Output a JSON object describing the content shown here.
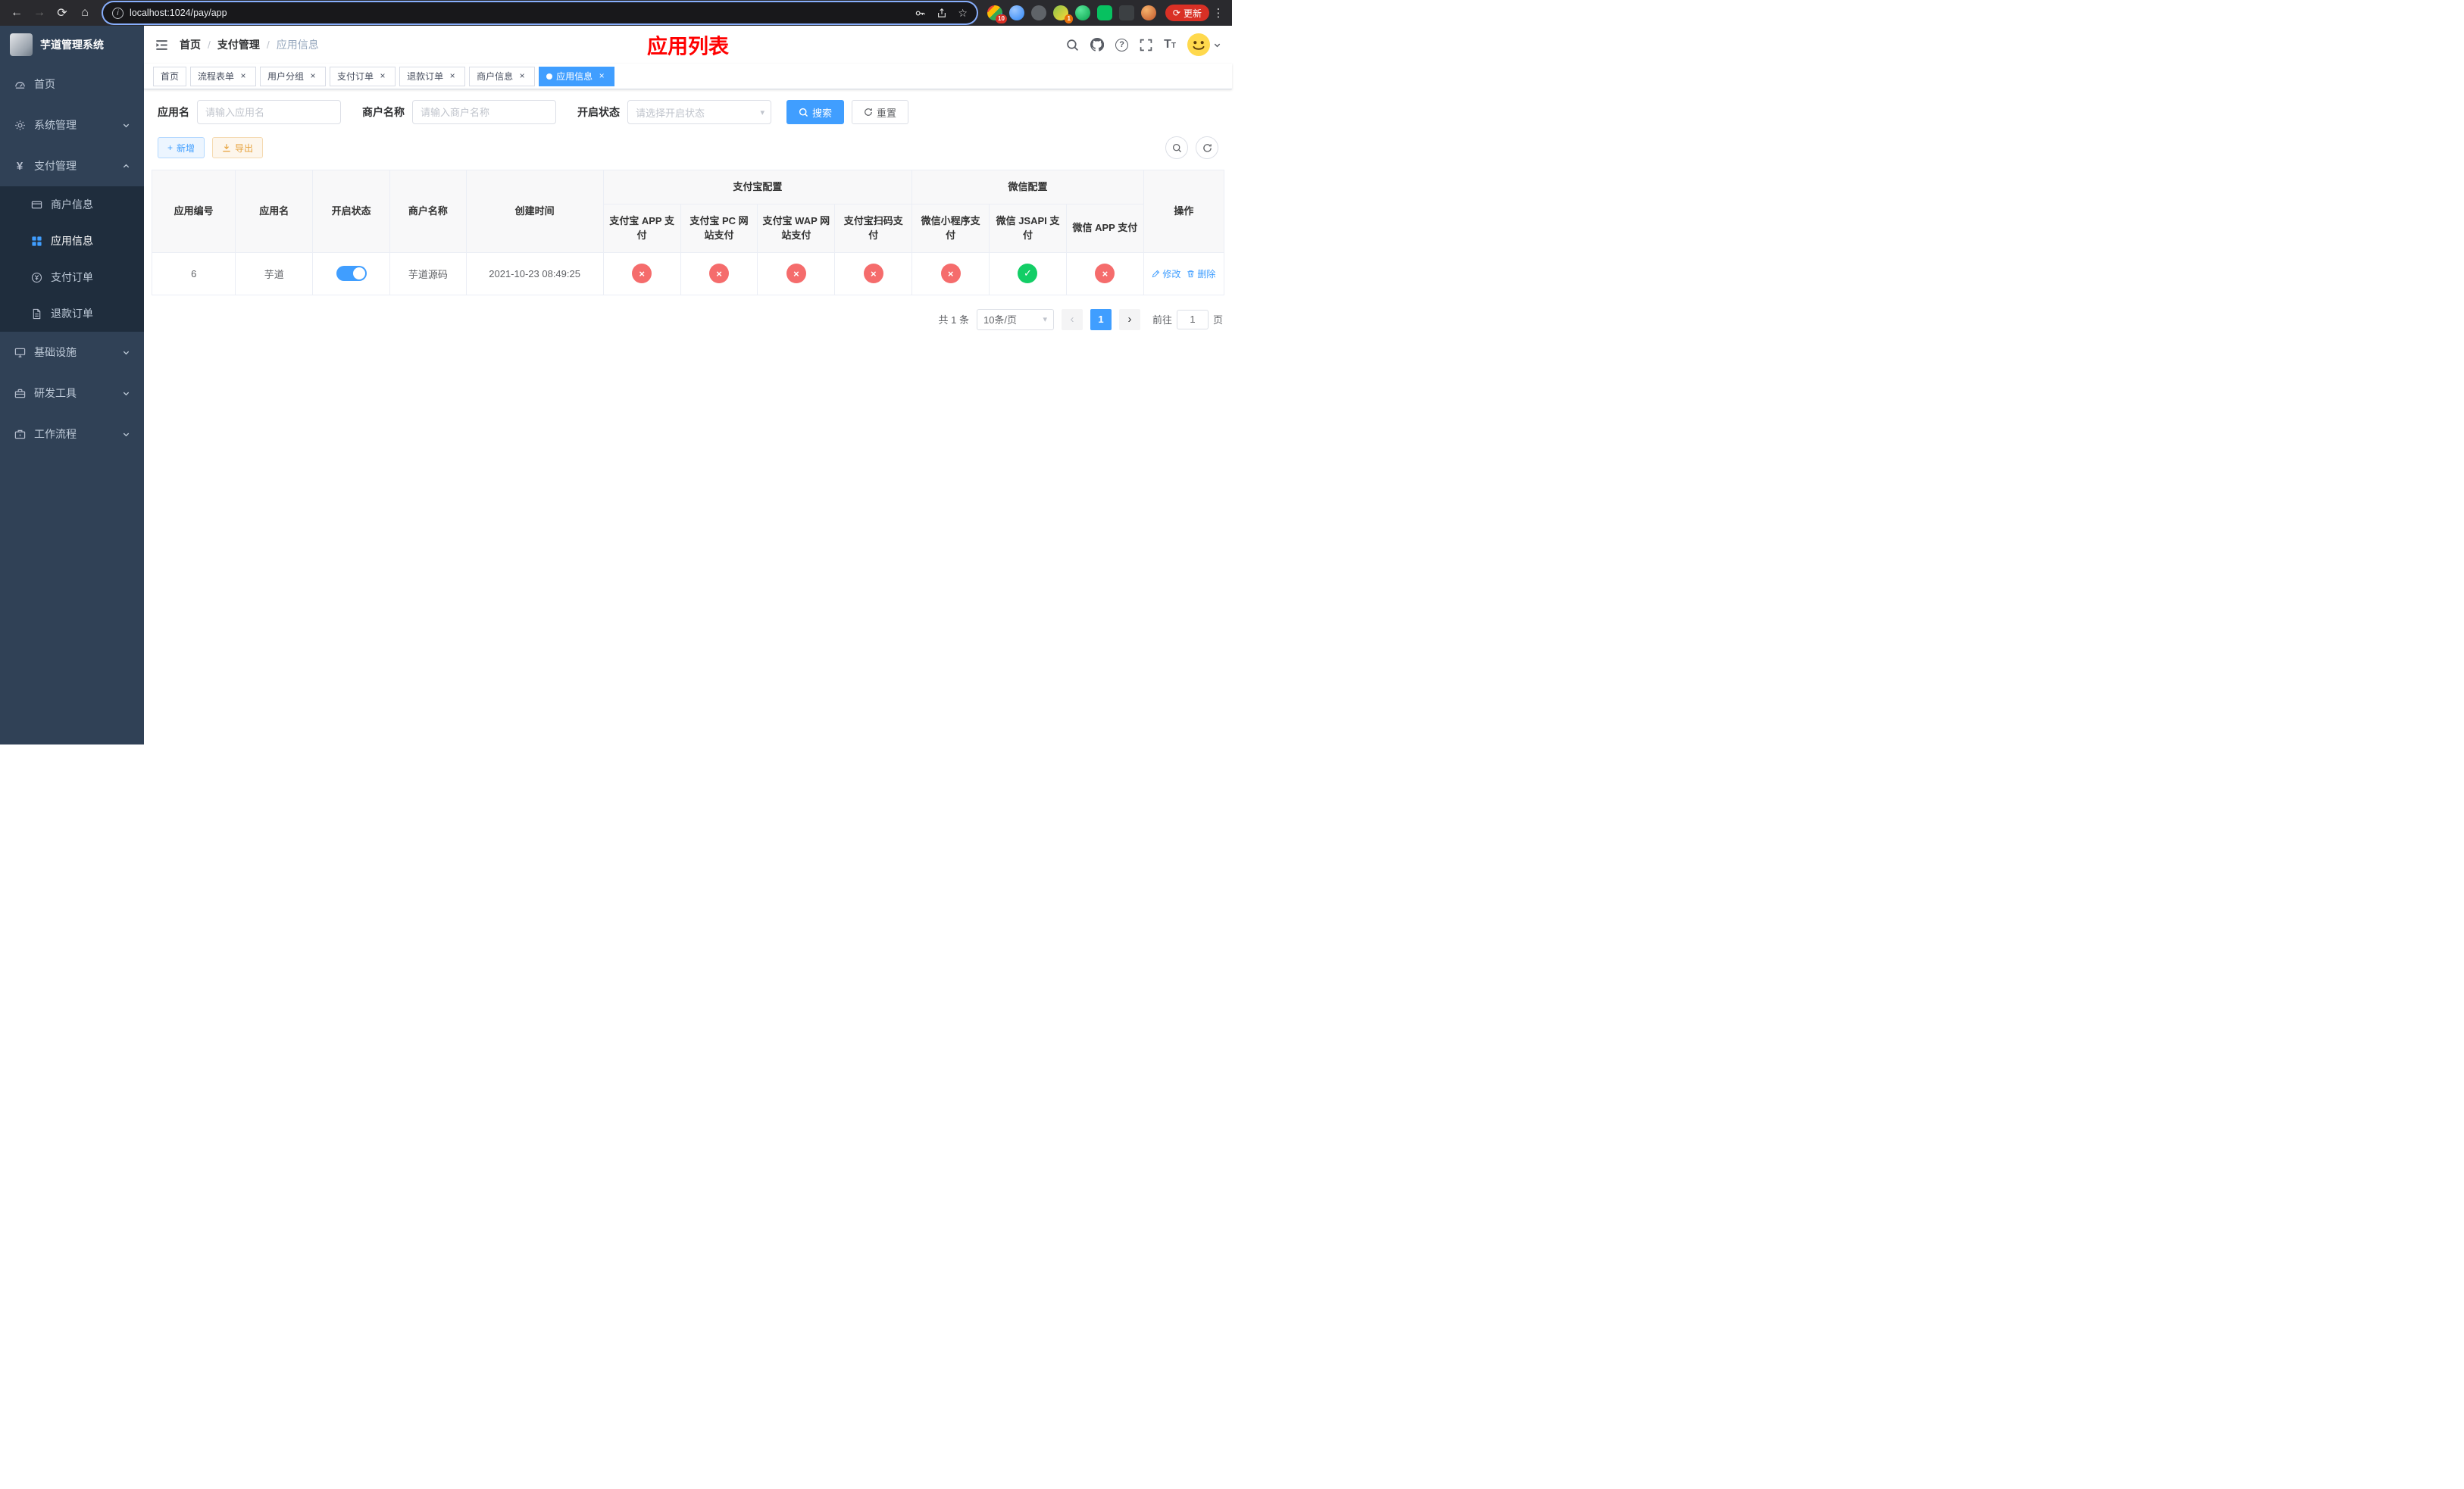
{
  "browser": {
    "url": "localhost:1024/pay/app",
    "update_label": "更新",
    "ext_badge_1": "10",
    "ext_badge_2": "1"
  },
  "icons": {
    "back": "←",
    "forward": "→",
    "reload": "⟳",
    "home": "⌂",
    "info": "i",
    "star": "☆",
    "kebab": "⋮",
    "close": "×",
    "dropdown_arrow": "▾",
    "prev": "‹",
    "next": "›",
    "question": "?",
    "plus": "+",
    "yen": "¥"
  },
  "sidebar": {
    "logo_title": "芋道管理系统",
    "items": [
      {
        "label": "首页"
      },
      {
        "label": "系统管理"
      },
      {
        "label": "支付管理"
      },
      {
        "label": "基础设施"
      },
      {
        "label": "研发工具"
      },
      {
        "label": "工作流程"
      }
    ],
    "pay_children": [
      {
        "label": "商户信息"
      },
      {
        "label": "应用信息"
      },
      {
        "label": "支付订单"
      },
      {
        "label": "退款订单"
      }
    ]
  },
  "navbar": {
    "breadcrumb": [
      "首页",
      "支付管理",
      "应用信息"
    ],
    "page_title": "应用列表"
  },
  "tabs": [
    {
      "label": "首页"
    },
    {
      "label": "流程表单"
    },
    {
      "label": "用户分组"
    },
    {
      "label": "支付订单"
    },
    {
      "label": "退款订单"
    },
    {
      "label": "商户信息"
    },
    {
      "label": "应用信息"
    }
  ],
  "filters": {
    "app_name_label": "应用名",
    "app_name_placeholder": "请输入应用名",
    "merchant_label": "商户名称",
    "merchant_placeholder": "请输入商户名称",
    "status_label": "开启状态",
    "status_placeholder": "请选择开启状态",
    "search_label": "搜索",
    "reset_label": "重置"
  },
  "toolbar": {
    "add_label": "新增",
    "export_label": "导出"
  },
  "table": {
    "headers": {
      "app_id": "应用编号",
      "app_name": "应用名",
      "status": "开启状态",
      "merchant": "商户名称",
      "created": "创建时间",
      "alipay_group": "支付宝配置",
      "wechat_group": "微信配置",
      "actions": "操作"
    },
    "alipay_columns": [
      "支付宝 APP 支付",
      "支付宝 PC 网站支付",
      "支付宝 WAP 网站支付",
      "支付宝扫码支付"
    ],
    "wechat_columns": [
      "微信小程序支付",
      "微信 JSAPI 支付",
      "微信 APP 支付"
    ],
    "rows": [
      {
        "app_id": "6",
        "app_name": "芋道",
        "enabled": true,
        "merchant": "芋道源码",
        "created": "2021-10-23 08:49:25",
        "pay_status": [
          false,
          false,
          false,
          false,
          false,
          true,
          false
        ],
        "edit_label": "修改",
        "delete_label": "删除"
      }
    ]
  },
  "pagination": {
    "total": "共 1 条",
    "page_size": "10条/页",
    "page": "1",
    "goto_label": "前往",
    "goto_value": "1",
    "goto_unit": "页"
  },
  "colors": {
    "primary": "#409eff",
    "danger": "#f56c6c",
    "success": "#13ce66",
    "title_red": "#ff0000",
    "sidebar_bg": "#304156",
    "submenu_bg": "#1f2d3d"
  }
}
